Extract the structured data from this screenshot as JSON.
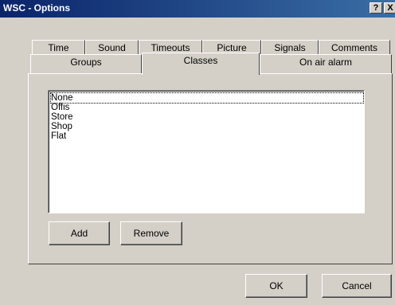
{
  "window": {
    "title": "WSC - Options",
    "help_label": "?",
    "close_label": "X"
  },
  "tabs_row1": [
    "Time",
    "Sound",
    "Timeouts",
    "Picture",
    "Signals",
    "Comments"
  ],
  "tabs_row2": [
    "Groups",
    "Classes",
    "On air alarm"
  ],
  "active_tab": "Classes",
  "classes": {
    "items": [
      "None",
      "Offis",
      "Store",
      "Shop",
      "Flat"
    ],
    "selected": "None",
    "add_label": "Add",
    "remove_label": "Remove"
  },
  "footer": {
    "ok_label": "OK",
    "cancel_label": "Cancel"
  }
}
